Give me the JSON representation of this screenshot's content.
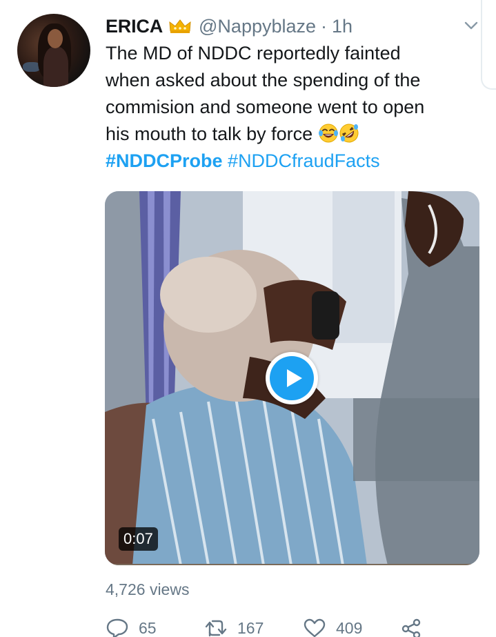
{
  "tweet": {
    "display_name": "ERICA",
    "badge_emoji": "crown-emoji",
    "handle": "@Nappyblaze",
    "separator": "·",
    "time": "1h",
    "text_lines": [
      "The MD of NDDC reportedly fainted",
      "when asked about the spending of the",
      "commision and someone went to open",
      "his mouth to talk by force"
    ],
    "emojis": [
      "tears-of-joy-emoji",
      "rolling-on-floor-laughing-emoji"
    ],
    "hashtags": [
      "#NDDCProbe",
      "#NDDCfraudFacts"
    ],
    "video": {
      "duration": "0:07",
      "play_icon": "play-icon"
    },
    "views": "4,726 views",
    "actions": {
      "replies": "65",
      "retweets": "167",
      "likes": "409"
    }
  },
  "colors": {
    "accent": "#1da1f2",
    "text": "#14171a",
    "secondary": "#657786"
  }
}
